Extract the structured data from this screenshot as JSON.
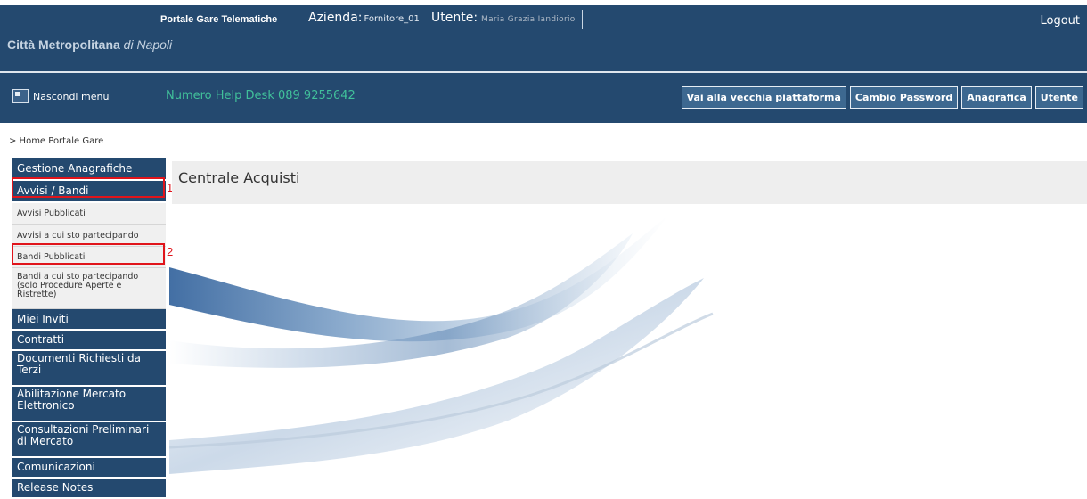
{
  "header": {
    "portal_name": "Portale Gare Telematiche",
    "azienda_label": "Azienda:",
    "azienda_value": "Fornitore_01",
    "utente_label": "Utente:",
    "utente_value": "Maria Grazia Iandiorio",
    "logout": "Logout",
    "city": "Città Metropolitana",
    "city_suffix": "di Napoli"
  },
  "toolbar": {
    "hide_menu": "Nascondi menu",
    "helpdesk": "Numero Help Desk 089 9255642",
    "buttons": [
      "Vai alla vecchia piattaforma",
      "Cambio Password",
      "Anagrafica",
      "Utente"
    ]
  },
  "breadcrumb": "> Home Portale Gare",
  "sidebar": {
    "items": [
      {
        "label": "Gestione Anagrafiche"
      },
      {
        "label": "Avvisi / Bandi"
      },
      {
        "label": "Avvisi Pubblicati"
      },
      {
        "label": "Avvisi a cui sto partecipando"
      },
      {
        "label": "Bandi Pubblicati"
      },
      {
        "label": "Bandi a cui sto partecipando (solo Procedure Aperte e Ristrette)"
      },
      {
        "label": "Miei Inviti"
      },
      {
        "label": "Contratti"
      },
      {
        "label": "Documenti Richiesti da Terzi"
      },
      {
        "label": "Abilitazione Mercato Elettronico"
      },
      {
        "label": "Consultazioni Preliminari di Mercato"
      },
      {
        "label": "Comunicazioni"
      },
      {
        "label": "Release Notes"
      }
    ]
  },
  "annotations": {
    "marker1": "1",
    "marker2": "2"
  },
  "main": {
    "title": "Centrale Acquisti"
  },
  "colors": {
    "header_bg": "#24496f",
    "helpdesk_text": "#41c09a",
    "marker": "#e0141b"
  }
}
